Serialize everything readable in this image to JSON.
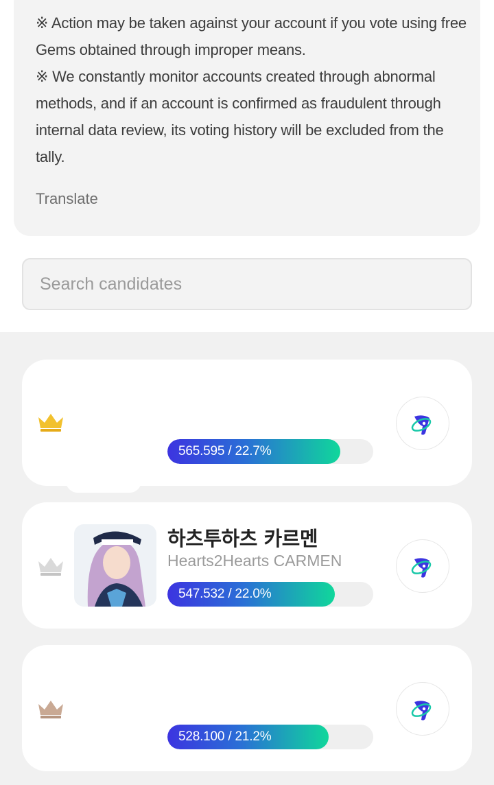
{
  "notice": {
    "line1": "※ Action may be taken against your account if you vote using free Gems obtained through improper means.",
    "line2": "※ We constantly monitor accounts created through abnormal methods, and if an account is confirmed as fraudulent through internal data review, its voting history will be excluded from the tally.",
    "translate_label": "Translate"
  },
  "search": {
    "placeholder": "Search candidates",
    "value": ""
  },
  "candidates": [
    {
      "rank": 1,
      "crown": "gold-crown-icon",
      "name": "",
      "subtitle": "",
      "votes_label": "565.595 / 22.7%",
      "share_percent": 22.7,
      "vote_icon": "vote-logo-icon"
    },
    {
      "rank": 2,
      "crown": "silver-crown-icon",
      "name": "하츠투하츠 카르멘",
      "subtitle": "Hearts2Hearts CARMEN",
      "votes_label": "547.532 / 22.0%",
      "share_percent": 22.0,
      "vote_icon": "vote-logo-icon"
    },
    {
      "rank": 3,
      "crown": "bronze-crown-icon",
      "name": "",
      "subtitle": "",
      "votes_label": "528.100 / 21.2%",
      "share_percent": 21.2,
      "vote_icon": "vote-logo-icon"
    }
  ],
  "colors": {
    "gold": "#f2c12e",
    "silver": "#d4d4d4",
    "bronze": "#c4a48c",
    "bar_start": "#3c34e0",
    "bar_end": "#10d79b"
  }
}
